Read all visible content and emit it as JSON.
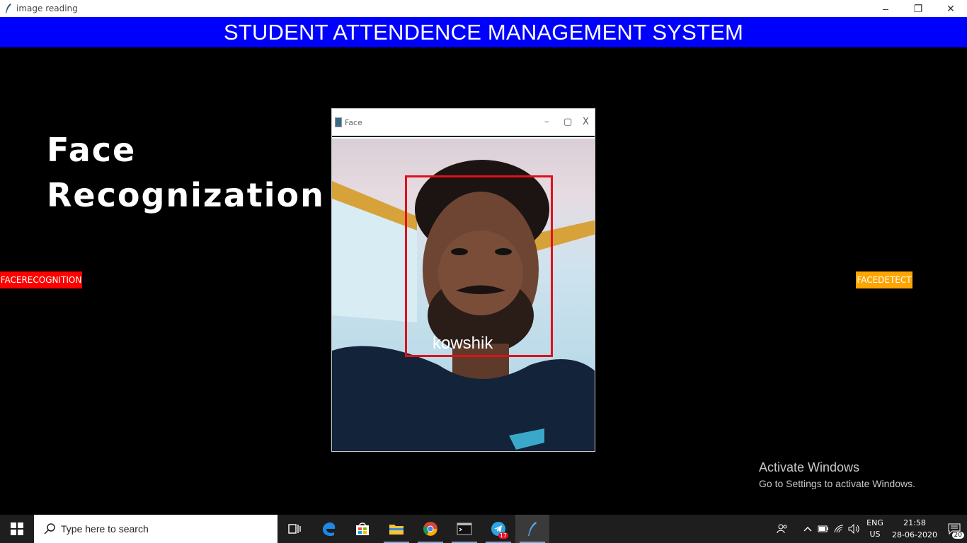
{
  "window": {
    "title": "image reading",
    "controls": {
      "minimize": "–",
      "restore": "❐",
      "close": "✕"
    }
  },
  "banner": {
    "text": "STUDENT ATTENDENCE MANAGEMENT SYSTEM",
    "color": "#0000ff"
  },
  "headline": {
    "line1": "Face",
    "line2": "Recognization"
  },
  "buttons": {
    "recognition": {
      "label": "FACERECOGNITION",
      "color": "#ff0000"
    },
    "detect": {
      "label": "FACEDETECT",
      "color": "#ffa500"
    }
  },
  "face_window": {
    "title": "Face",
    "controls": {
      "minimize": "–",
      "maximize": "▢",
      "close": "X"
    },
    "detected_name": "kowshik",
    "bbox_color": "#e0101a"
  },
  "watermark": {
    "title": "Activate Windows",
    "subtitle": "Go to Settings to activate Windows."
  },
  "taskbar": {
    "search_placeholder": "Type here to search",
    "telegram_badge": "17",
    "lang_top": "ENG",
    "lang_bottom": "US",
    "time": "21:58",
    "date": "28-06-2020",
    "notification_count": "20"
  }
}
